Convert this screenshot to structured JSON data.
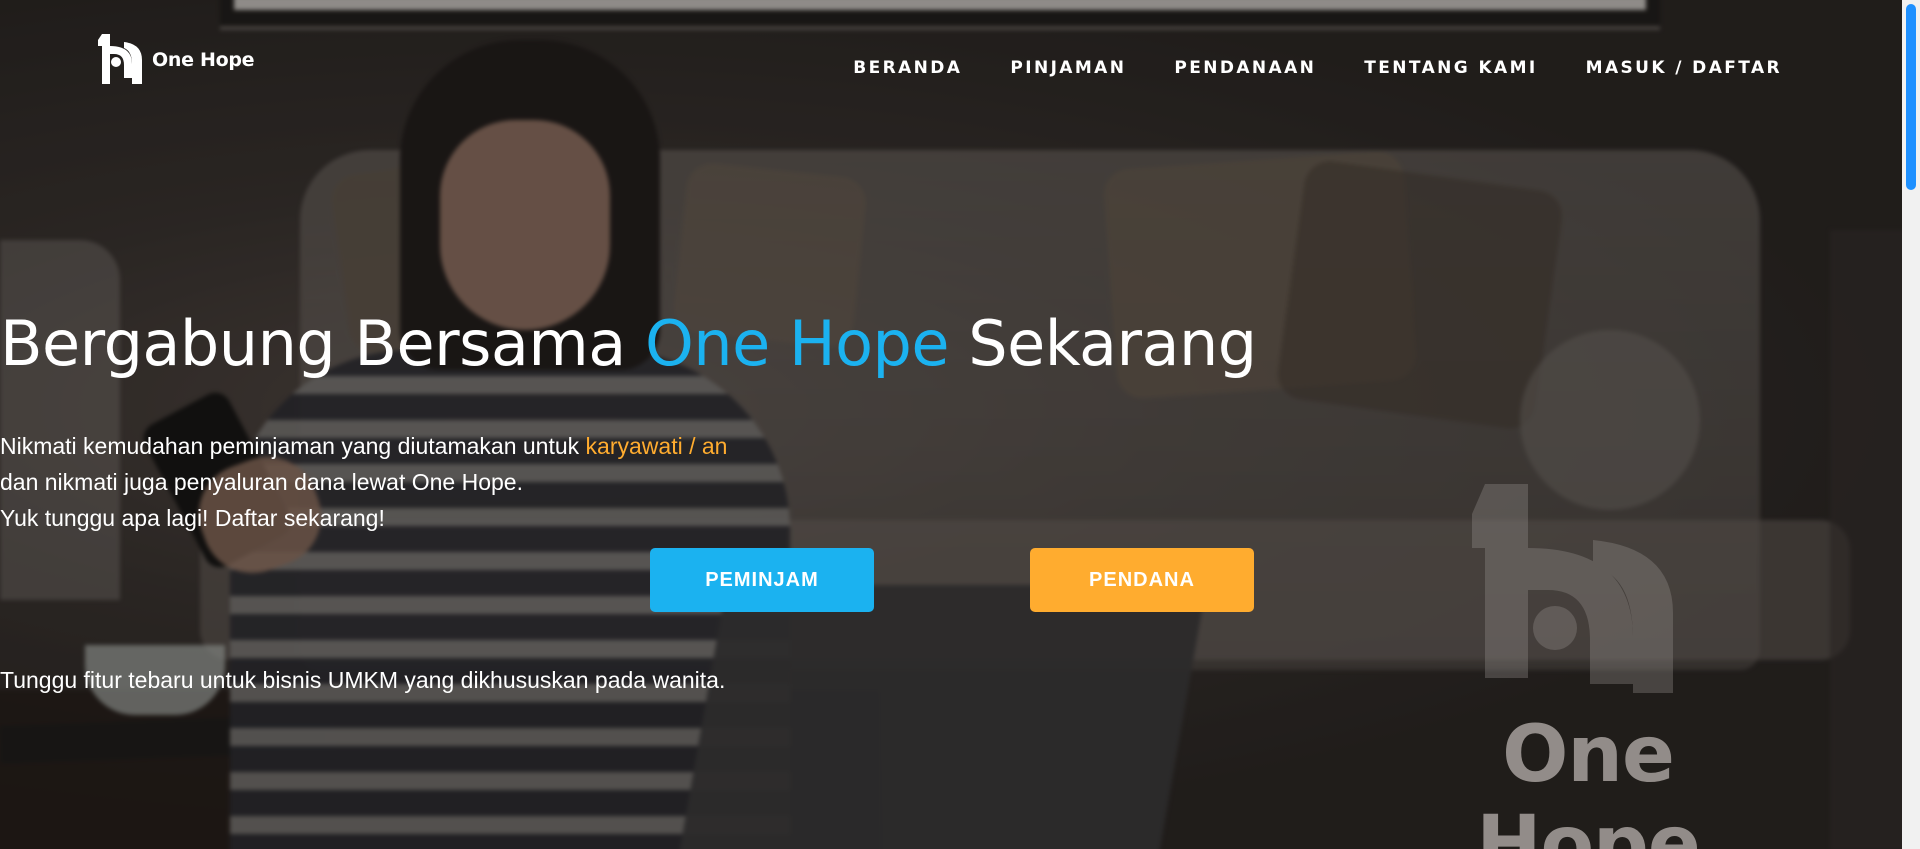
{
  "brand": {
    "name": "One Hope",
    "logo_icon": "one-hope-logo-icon"
  },
  "nav": [
    {
      "label": "BERANDA"
    },
    {
      "label": "PINJAMAN"
    },
    {
      "label": "PENDANAAN"
    },
    {
      "label": "TENTANG KAMI"
    },
    {
      "label": "MASUK / DAFTAR"
    }
  ],
  "hero": {
    "title_prefix": "Bergabung Bersama ",
    "title_highlight": "One Hope",
    "title_suffix": " Sekarang",
    "desc_line1_prefix": "Nikmati kemudahan peminjaman yang diutamakan untuk ",
    "desc_line1_highlight": "karyawati / an",
    "desc_line2": "dan nikmati juga penyaluran dana lewat One Hope.",
    "desc_line3": "Yuk tunggu apa lagi! Daftar sekarang!",
    "btn_borrower": "PEMINJAM",
    "btn_lender": "PENDANA",
    "note": "Tunggu fitur tebaru untuk bisnis UMKM yang dikhususkan pada wanita."
  },
  "watermark": {
    "text": "One Hope"
  },
  "colors": {
    "accent_blue": "#1bb2f0",
    "accent_orange": "#ffac2f",
    "scroll_thumb": "#1e90ff"
  }
}
